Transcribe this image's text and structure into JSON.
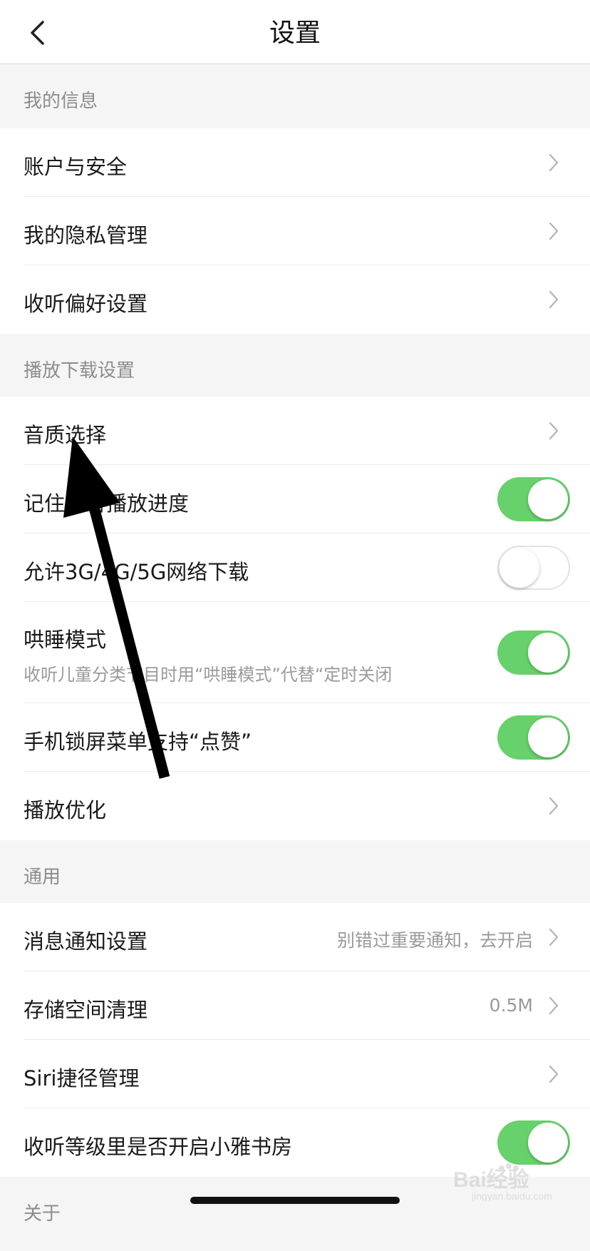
{
  "header": {
    "title": "设置",
    "back_icon": "chevron-left-icon"
  },
  "sections": {
    "my_info": {
      "title": "我的信息",
      "account": "账户与安全",
      "privacy": "我的隐私管理",
      "listen_pref": "收听偏好设置"
    },
    "playback": {
      "title": "播放下载设置",
      "quality": "音质选择",
      "remember_progress": {
        "label": "记住声音播放进度",
        "on": true
      },
      "mobile_download": {
        "label": "允许3G/4G/5G网络下载",
        "on": false
      },
      "lullaby": {
        "label": "哄睡模式",
        "sub": "收听儿童分类节目时用“哄睡模式”代替“定时关闭",
        "on": true
      },
      "lockscreen_like": {
        "label": "手机锁屏菜单支持“点赞”",
        "on": true
      },
      "optimize": "播放优化"
    },
    "general": {
      "title": "通用",
      "notify": {
        "label": "消息通知设置",
        "value": "别错过重要通知，去开启"
      },
      "storage": {
        "label": "存储空间清理",
        "value": "0.5M"
      },
      "siri": "Siri捷径管理",
      "study_room": {
        "label": "收听等级里是否开启小雅书房",
        "on": true
      }
    },
    "about": {
      "title": "关于"
    }
  },
  "watermark": {
    "text": "Bai经验",
    "sub": "jingyan.baidu.com"
  },
  "colors": {
    "toggle_on": "#67d16b",
    "section_bg": "#f5f5f5",
    "row_bg": "#ffffff",
    "annotation_arrow": "#000000"
  },
  "icons": {
    "chevron": "chevron-right-icon",
    "annotation": "arrow-annotation"
  }
}
